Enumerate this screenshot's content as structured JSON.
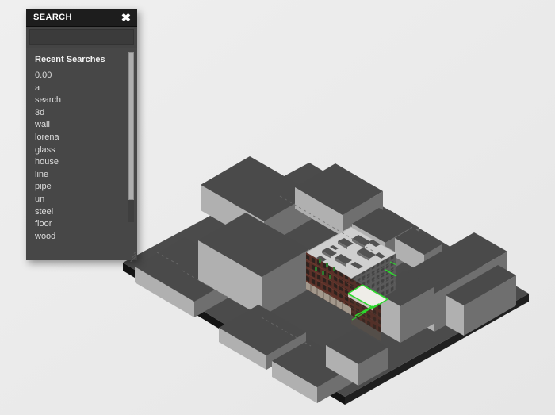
{
  "app": {
    "background_color": "#ebebeb"
  },
  "search_panel": {
    "title": "SEARCH",
    "close_icon": "close-x-icon",
    "input": {
      "value": "",
      "placeholder": ""
    },
    "recent_section_label": "Recent Searches",
    "recent_searches": [
      "0.00",
      "a",
      "search",
      "3d",
      "wall",
      "lorena",
      "glass",
      "house",
      "line",
      "pipe",
      "un",
      "steel",
      "floor",
      "wood"
    ],
    "scrollbar": {
      "name": "vertical-scrollbar"
    },
    "resize_handle": "resize-grip-icon",
    "colors": {
      "header_bg": "#1d1d1d",
      "panel_bg": "#474747",
      "input_bg": "#3b3b3b",
      "text": "#dcdcdc",
      "title_text": "#ffffff"
    }
  },
  "scene": {
    "name": "isometric-3d-site-model",
    "description": "Isometric 3D architectural massing model on a dark slab with one detailed red-brick building at the center",
    "colors": {
      "slab_top": "#4b4b4b",
      "slab_edge": "#1f1f1f",
      "mass_top": "#4a4a4a",
      "mass_left": "#b3b3b3",
      "mass_right": "#6f6f6f",
      "brick": "#5a3028",
      "roof": "#cfcfcf",
      "accent_green": "#2ed82e"
    }
  }
}
